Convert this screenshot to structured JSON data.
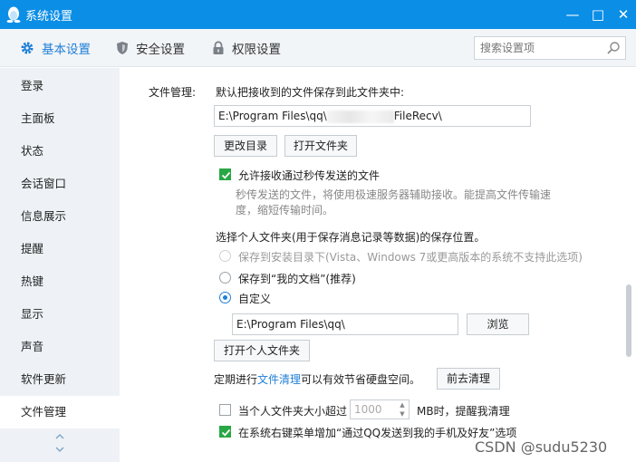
{
  "window": {
    "title": "系统设置",
    "minimize": "—",
    "maximize": "□",
    "close": "✕"
  },
  "tabs": [
    {
      "label": "基本设置",
      "icon": "gear-icon",
      "active": true
    },
    {
      "label": "安全设置",
      "icon": "shield-icon",
      "active": false
    },
    {
      "label": "权限设置",
      "icon": "lock-icon",
      "active": false
    }
  ],
  "search": {
    "placeholder": "搜索设置项"
  },
  "sidebar": {
    "items": [
      {
        "label": "登录"
      },
      {
        "label": "主面板"
      },
      {
        "label": "状态"
      },
      {
        "label": "会话窗口"
      },
      {
        "label": "信息展示"
      },
      {
        "label": "提醒"
      },
      {
        "label": "热键"
      },
      {
        "label": "显示"
      },
      {
        "label": "声音"
      },
      {
        "label": "软件更新"
      },
      {
        "label": "文件管理"
      }
    ],
    "active_index": 10
  },
  "file_mgmt": {
    "section_label": "文件管理:",
    "receive_desc": "默认把接收到的文件保存到此文件夹中:",
    "receive_path_prefix": "E:\\Program Files\\qq\\",
    "receive_path_suffix": "FileRecv\\",
    "change_dir_button": "更改目录",
    "open_folder_button": "打开文件夹",
    "allow_flash_label": "允许接收通过秒传发送的文件",
    "allow_flash_checked": true,
    "flash_hint_line1": "秒传发送的文件，将使用极速服务器辅助接收。能提高文件传输速",
    "flash_hint_line2": "度，缩短传输时间。",
    "personal_folder_desc": "选择个人文件夹(用于保存消息记录等数据)的保存位置。",
    "option_install_dir": "保存到安装目录下(Vista、Windows 7或更高版本的系统不支持此选项)",
    "option_my_docs": "保存到“我的文档”(推荐)",
    "option_custom": "自定义",
    "custom_path": "E:\\Program Files\\qq\\",
    "browse_button": "浏览",
    "open_personal_button": "打开个人文件夹",
    "cleanup_prefix": "定期进行",
    "cleanup_link": "文件清理",
    "cleanup_suffix": "可以有效节省硬盘空间。",
    "goto_cleanup_button": "前去清理",
    "size_limit_prefix": "当个人文件夹大小超过",
    "size_limit_value": "1000",
    "size_limit_suffix": "MB时，提醒我清理",
    "size_limit_checked": false,
    "context_menu_label": "在系统右键菜单增加“通过QQ发送到我的手机及好友”选项",
    "context_menu_checked": true
  },
  "watermark": "CSDN @sudu5230",
  "colors": {
    "titlebar": "#0b8ee6",
    "accent": "#1f7fd6",
    "check_green": "#28a745"
  }
}
